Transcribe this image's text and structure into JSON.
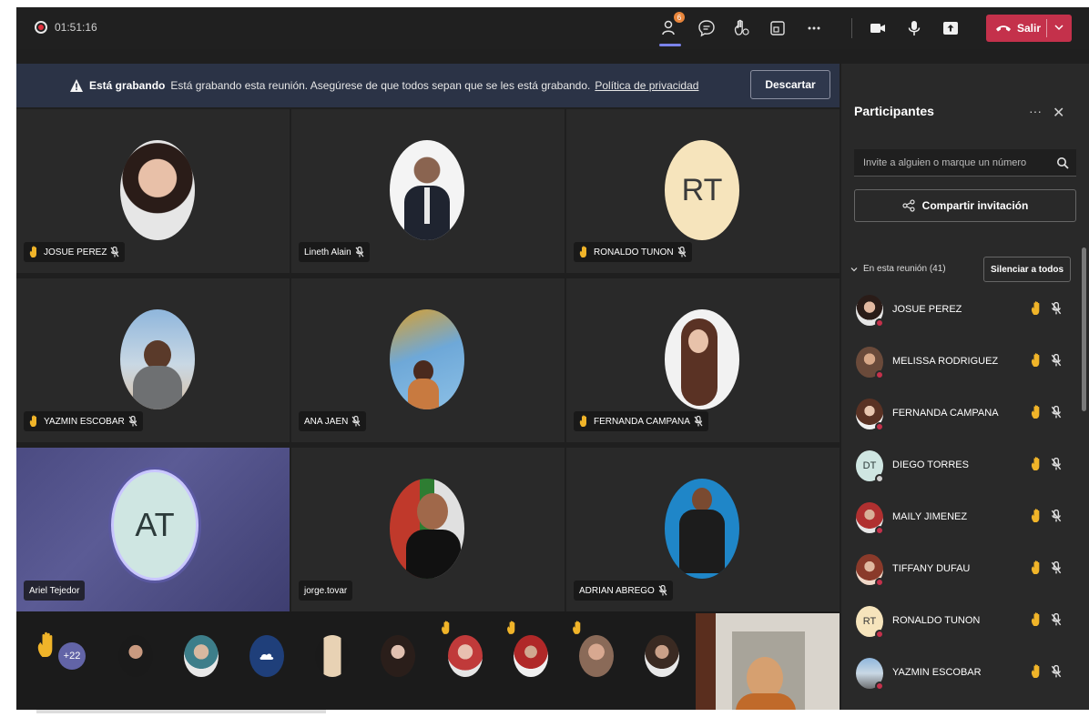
{
  "topbar": {
    "timer": "01:51:16",
    "participants_badge": "6",
    "leave_label": "Salir",
    "icons": [
      "participants-icon",
      "chat-icon",
      "reactions-icon",
      "rooms-icon",
      "more-icon",
      "camera-icon",
      "mic-icon",
      "share-icon",
      "phone-icon"
    ]
  },
  "banner": {
    "title": "Está grabando",
    "text": "Está grabando esta reunión. Asegúrese de que todos sepan que se les está grabando.",
    "link": "Política de privacidad",
    "dismiss": "Descartar"
  },
  "tiles": [
    {
      "name": "JOSUE PEREZ",
      "hand": true,
      "muted": true
    },
    {
      "name": "Lineth Alain",
      "hand": false,
      "muted": true
    },
    {
      "name": "RONALDO TUNON",
      "hand": true,
      "muted": true,
      "initials": "RT"
    },
    {
      "name": "YAZMIN ESCOBAR",
      "hand": true,
      "muted": true
    },
    {
      "name": "ANA JAEN",
      "hand": false,
      "muted": true
    },
    {
      "name": "FERNANDA CAMPANA",
      "hand": true,
      "muted": true
    },
    {
      "name": "Ariel Tejedor",
      "hand": false,
      "muted": false,
      "initials": "AT"
    },
    {
      "name": "jorge.tovar",
      "hand": false,
      "muted": false
    },
    {
      "name": "ADRIAN ABREGO",
      "hand": false,
      "muted": true
    }
  ],
  "strip": {
    "more_count": "+22"
  },
  "panel": {
    "title": "Participantes",
    "more": "···",
    "close": "✕",
    "invite_placeholder": "Invite a alguien o marque un número",
    "share_invite": "Compartir invitación",
    "section_label": "En esta reunión (41)",
    "mute_all": "Silenciar a todos",
    "participants": [
      {
        "name": "JOSUE PEREZ"
      },
      {
        "name": "MELISSA RODRIGUEZ"
      },
      {
        "name": "FERNANDA CAMPANA"
      },
      {
        "name": "DIEGO TORRES",
        "initials": "DT"
      },
      {
        "name": "MAILY JIMENEZ"
      },
      {
        "name": "TIFFANY DUFAU"
      },
      {
        "name": "RONALDO TUNON",
        "initials": "RT"
      },
      {
        "name": "YAZMIN ESCOBAR"
      }
    ]
  },
  "colors": {
    "accent": "#6264a7",
    "leave": "#c4314b",
    "hand": "#f0b429",
    "banner": "#2b3346"
  }
}
